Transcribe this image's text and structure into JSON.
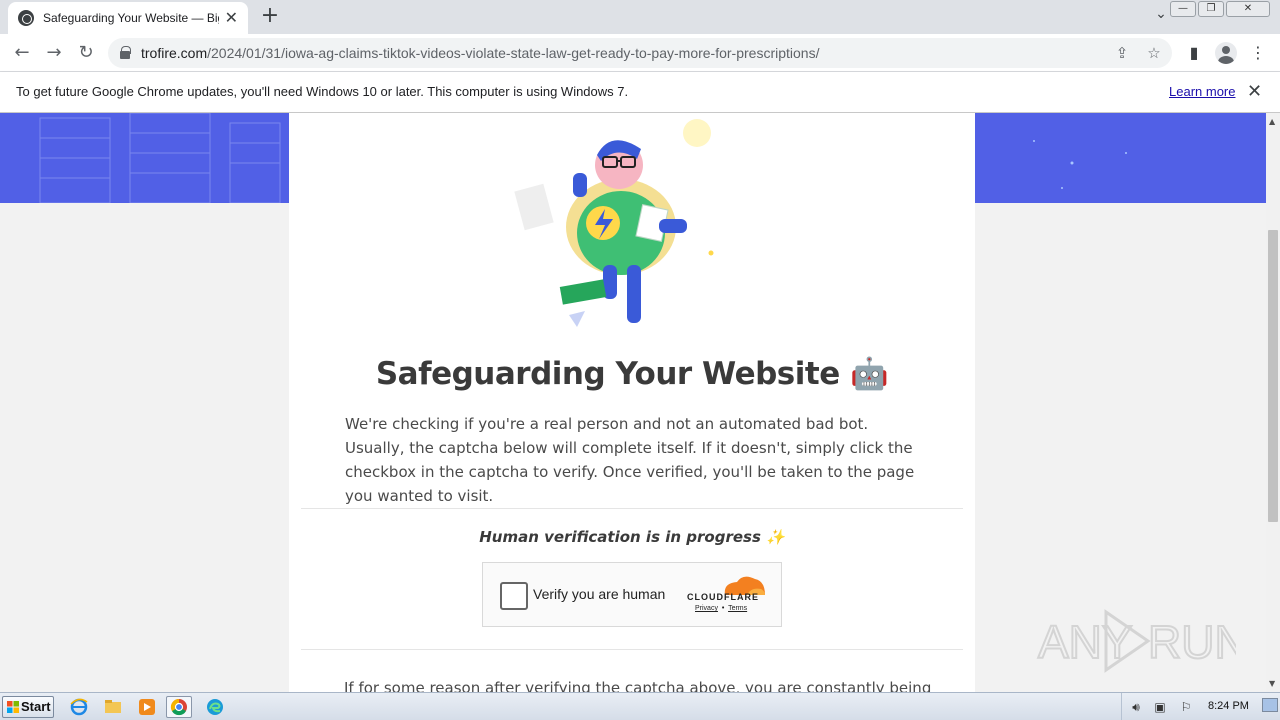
{
  "browser": {
    "tab_title": "Safeguarding Your Website — BigScoots",
    "tab_close": "✕",
    "new_tab": "+",
    "url_host": "trofire.com",
    "url_path": "/2024/01/31/iowa-ag-claims-tiktok-videos-violate-state-law-get-ready-to-pay-more-for-prescriptions/",
    "window_buttons": [
      "—",
      "❐",
      "✕"
    ]
  },
  "infobar": {
    "message": "To get future Google Chrome updates, you'll need Windows 10 or later. This computer is using Windows 7.",
    "link": "Learn more",
    "close": "✕"
  },
  "page": {
    "headline": "Safeguarding Your Website 🤖",
    "paragraph": "We're checking if you're a real person and not an automated bad bot. Usually, the captcha below will complete itself. If it doesn't, simply click the checkbox in the captcha to verify. Once verified, you'll be taken to the page you wanted to visit.",
    "verification_status": "Human verification is in progress ✨",
    "footer_text": "If for some reason after verifying the captcha above, you are constantly being"
  },
  "captcha": {
    "checkbox_label": "Verify you are human",
    "brand": "CLOUDFLARE",
    "privacy_link": "Privacy",
    "separator": "•",
    "terms_link": "Terms"
  },
  "watermark": {
    "text_left": "ANY",
    "text_right": "RUN"
  },
  "taskbar": {
    "start_label": "Start",
    "clock": "8:24 PM",
    "apps": [
      "internet-explorer",
      "file-explorer",
      "media-player",
      "chrome",
      "edge"
    ]
  },
  "colors": {
    "banner": "#5160e6",
    "link": "#1a0dab",
    "cloudflare_orange": "#f38020"
  }
}
